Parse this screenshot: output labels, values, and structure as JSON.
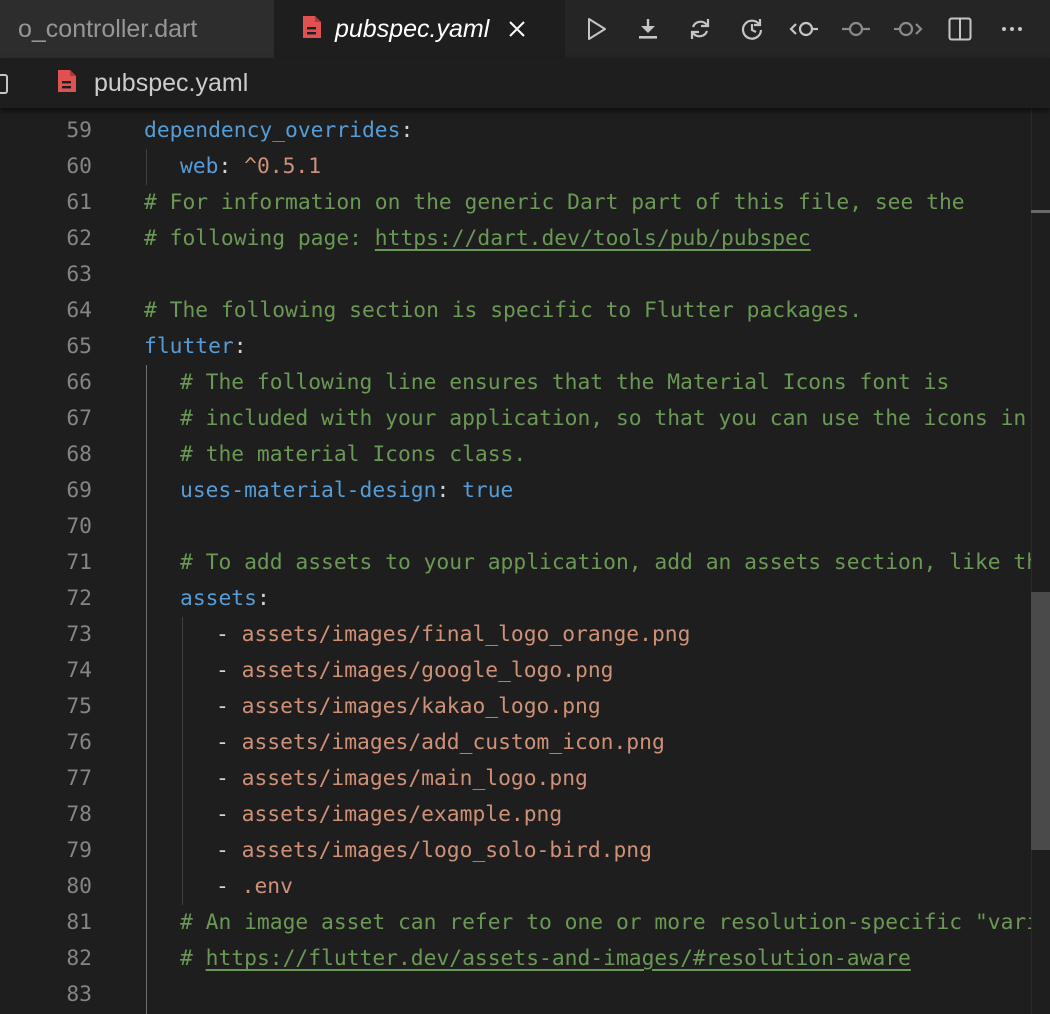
{
  "tabs": [
    {
      "label": "o_controller.dart",
      "active": false,
      "icon": "dart-file-icon"
    },
    {
      "label": "pubspec.yaml",
      "active": true,
      "icon": "yaml-file-icon"
    }
  ],
  "toolbar": {
    "actions": [
      "run-icon",
      "download-icon",
      "refresh-icon",
      "restart-icon",
      "step-back-icon",
      "commit-icon",
      "step-forward-icon",
      "split-editor-icon",
      "more-icon"
    ]
  },
  "breadcrumb": {
    "file": "pubspec.yaml"
  },
  "colors": {
    "key": "#569cd6",
    "string": "#ce9178",
    "comment": "#6a9955",
    "line_number": "#858585",
    "file_icon": "#e05252",
    "background": "#1e1e1e"
  },
  "editor": {
    "lines": [
      {
        "n": "59",
        "indent": 0,
        "tokens": [
          {
            "t": "dependency_overrides",
            "c": "k"
          },
          {
            "t": ":",
            "c": "p"
          }
        ]
      },
      {
        "n": "60",
        "indent": 1,
        "tokens": [
          {
            "t": "web",
            "c": "k"
          },
          {
            "t": ": ",
            "c": "p"
          },
          {
            "t": "^0.5.1",
            "c": "s"
          }
        ]
      },
      {
        "n": "61",
        "indent": 0,
        "tokens": [
          {
            "t": "# For information on the generic Dart part of this file, see the",
            "c": "c"
          }
        ]
      },
      {
        "n": "62",
        "indent": 0,
        "tokens": [
          {
            "t": "# following page: ",
            "c": "c"
          },
          {
            "t": "https://dart.dev/tools/pub/pubspec",
            "c": "u"
          }
        ]
      },
      {
        "n": "63",
        "indent": 0,
        "tokens": []
      },
      {
        "n": "64",
        "indent": 0,
        "tokens": [
          {
            "t": "# The following section is specific to Flutter packages.",
            "c": "c"
          }
        ]
      },
      {
        "n": "65",
        "indent": 0,
        "tokens": [
          {
            "t": "flutter",
            "c": "k"
          },
          {
            "t": ":",
            "c": "p"
          }
        ]
      },
      {
        "n": "66",
        "indent": 1,
        "tokens": [
          {
            "t": "# The following line ensures that the Material Icons font is",
            "c": "c"
          }
        ]
      },
      {
        "n": "67",
        "indent": 1,
        "tokens": [
          {
            "t": "# included with your application, so that you can use the icons in",
            "c": "c"
          }
        ]
      },
      {
        "n": "68",
        "indent": 1,
        "tokens": [
          {
            "t": "# the material Icons class.",
            "c": "c"
          }
        ]
      },
      {
        "n": "69",
        "indent": 1,
        "tokens": [
          {
            "t": "uses-material-design",
            "c": "k"
          },
          {
            "t": ": ",
            "c": "p"
          },
          {
            "t": "true",
            "c": "b"
          }
        ]
      },
      {
        "n": "70",
        "indent": 1,
        "tokens": []
      },
      {
        "n": "71",
        "indent": 1,
        "tokens": [
          {
            "t": "# To add assets to your application, add an assets section, like this:",
            "c": "c"
          }
        ]
      },
      {
        "n": "72",
        "indent": 1,
        "tokens": [
          {
            "t": "assets",
            "c": "k"
          },
          {
            "t": ":",
            "c": "p"
          }
        ]
      },
      {
        "n": "73",
        "indent": 2,
        "tokens": [
          {
            "t": "- ",
            "c": "p"
          },
          {
            "t": "assets/images/final_logo_orange.png",
            "c": "s"
          }
        ]
      },
      {
        "n": "74",
        "indent": 2,
        "tokens": [
          {
            "t": "- ",
            "c": "p"
          },
          {
            "t": "assets/images/google_logo.png",
            "c": "s"
          }
        ]
      },
      {
        "n": "75",
        "indent": 2,
        "tokens": [
          {
            "t": "- ",
            "c": "p"
          },
          {
            "t": "assets/images/kakao_logo.png",
            "c": "s"
          }
        ]
      },
      {
        "n": "76",
        "indent": 2,
        "tokens": [
          {
            "t": "- ",
            "c": "p"
          },
          {
            "t": "assets/images/add_custom_icon.png",
            "c": "s"
          }
        ]
      },
      {
        "n": "77",
        "indent": 2,
        "tokens": [
          {
            "t": "- ",
            "c": "p"
          },
          {
            "t": "assets/images/main_logo.png",
            "c": "s"
          }
        ]
      },
      {
        "n": "78",
        "indent": 2,
        "tokens": [
          {
            "t": "- ",
            "c": "p"
          },
          {
            "t": "assets/images/example.png",
            "c": "s"
          }
        ]
      },
      {
        "n": "79",
        "indent": 2,
        "tokens": [
          {
            "t": "- ",
            "c": "p"
          },
          {
            "t": "assets/images/logo_solo-bird.png",
            "c": "s"
          }
        ]
      },
      {
        "n": "80",
        "indent": 2,
        "tokens": [
          {
            "t": "- ",
            "c": "p"
          },
          {
            "t": ".env",
            "c": "s"
          }
        ]
      },
      {
        "n": "81",
        "indent": 1,
        "tokens": [
          {
            "t": "# An image asset can refer to one or more resolution-specific \"variants\",",
            "c": "c"
          }
        ]
      },
      {
        "n": "82",
        "indent": 1,
        "tokens": [
          {
            "t": "# ",
            "c": "c"
          },
          {
            "t": "https://flutter.dev/assets-and-images/#resolution-aware",
            "c": "u"
          }
        ]
      },
      {
        "n": "83",
        "indent": 1,
        "tokens": []
      }
    ]
  }
}
